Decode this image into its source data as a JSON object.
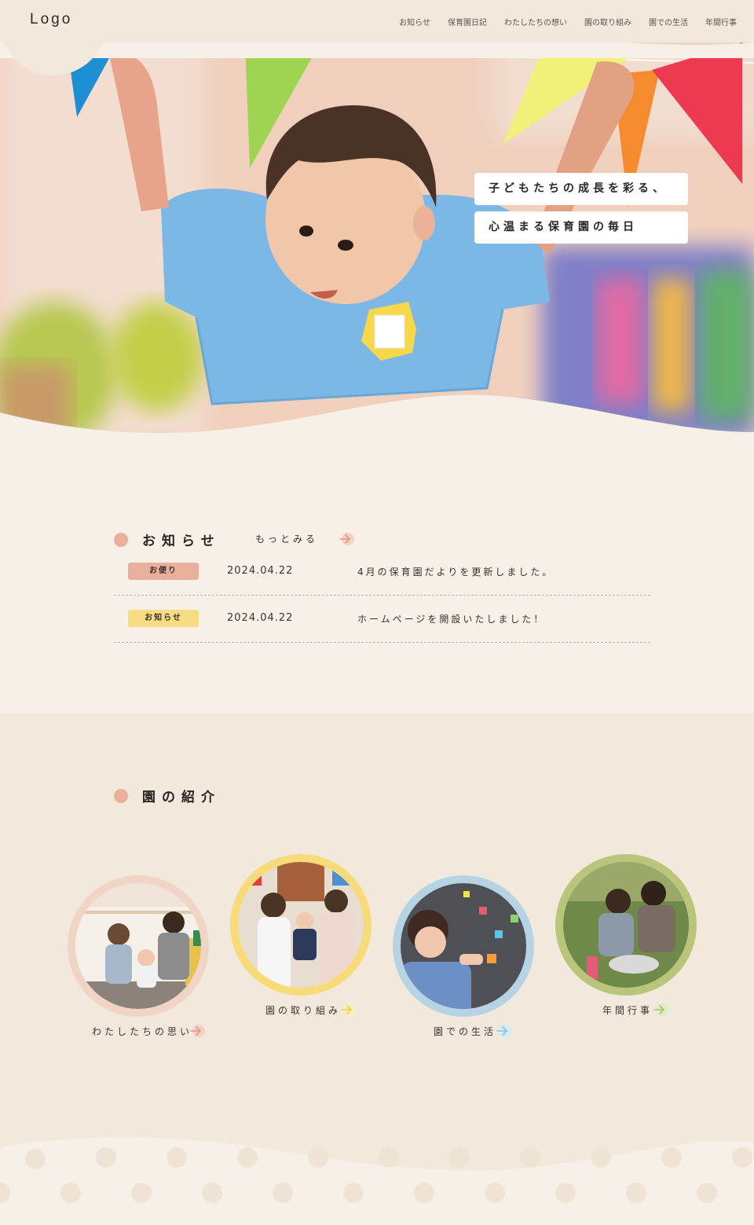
{
  "header": {
    "logo": "Logo",
    "nav": [
      "お知らせ",
      "保育園日記",
      "わたしたちの想い",
      "園の取り組み",
      "園での生活",
      "年間行事"
    ]
  },
  "hero": {
    "catch_line1": "子どもたちの成長を彩る、",
    "catch_line2": "心温まる保育園の毎日"
  },
  "news": {
    "title": "お知らせ",
    "more": "もっとみる",
    "items": [
      {
        "tag": "お便り",
        "tag_color": "#e8b09a",
        "date": "2024.04.22",
        "text": "4月の保育園だよりを更新しました。"
      },
      {
        "tag": "お知らせ",
        "tag_color": "#f6dc83",
        "date": "2024.04.22",
        "text": "ホームページを開設いたしました！"
      }
    ]
  },
  "intro": {
    "title": "園の紹介",
    "cards": [
      {
        "label": "わたしたちの思い",
        "ring_color": "#f0d4c6",
        "arrow_color": "#e8a594"
      },
      {
        "label": "園の取り組み",
        "ring_color": "#f7db78",
        "arrow_color": "#f3d76e"
      },
      {
        "label": "園での生活",
        "ring_color": "#b6d3e3",
        "arrow_color": "#a9d2ea"
      },
      {
        "label": "年間行事",
        "ring_color": "#b9c57a",
        "arrow_color": "#c3d58c"
      }
    ]
  },
  "colors": {
    "bg": "#f7f0e6",
    "header_bg": "#f2e8dc",
    "accent_dot": "#e8b09a"
  }
}
